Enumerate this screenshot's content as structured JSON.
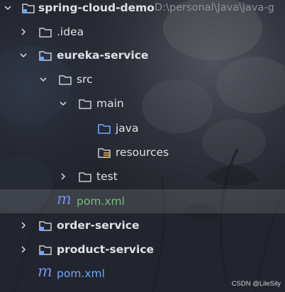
{
  "project_tree": {
    "root": {
      "name": "spring-cloud-demo",
      "path": "D:\\personal\\Java\\java-g"
    },
    "nodes": [
      {
        "label": ".idea"
      },
      {
        "label": "eureka-service"
      },
      {
        "label": "src"
      },
      {
        "label": "main"
      },
      {
        "label": "java"
      },
      {
        "label": "resources"
      },
      {
        "label": "test"
      },
      {
        "label": "pom.xml",
        "icon_text": "m"
      },
      {
        "label": "order-service"
      },
      {
        "label": "product-service"
      },
      {
        "label": "pom.xml",
        "icon_text": "m"
      }
    ]
  },
  "watermark": "CSDN @LileSily",
  "colors": {
    "folder": "#c9ccd2",
    "module_dot": "#6ea7ff",
    "source_folder": "#6ea7ff",
    "maven_icon": "#6f8fe6",
    "selected_row_label": "#73bd79",
    "root_pom_label": "#6ea7ff"
  }
}
